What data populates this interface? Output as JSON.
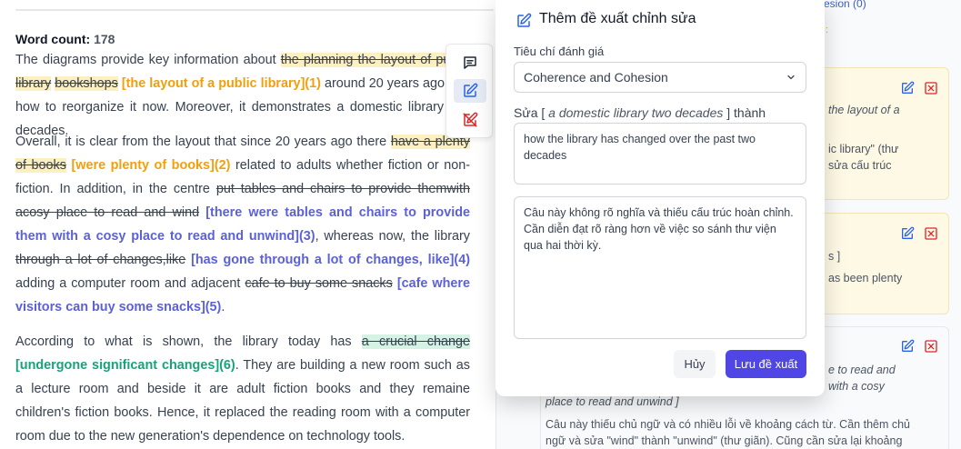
{
  "essay": {
    "word_count_label": "Word count:",
    "word_count_value": "178",
    "p1": [
      {
        "t": "The diagrams provide key information about ",
        "c": "plain"
      },
      {
        "t": "the planning the layout of public library",
        "c": "old-y"
      },
      {
        "t": " ",
        "c": "plain"
      },
      {
        "t": "bookshops",
        "c": "old-y"
      },
      {
        "t": " ",
        "c": "plain"
      },
      {
        "t": "[the layout of a public library](1)",
        "c": "sug-o"
      },
      {
        "t": " around 20 years ago and how to reorganize it now. Moreover, it demonstrates a domestic library two decades.",
        "c": "plain"
      }
    ],
    "p2": [
      {
        "t": "Overall, it is clear from the layout that since 20 years ago there ",
        "c": "plain"
      },
      {
        "t": "have a plenty of books",
        "c": "old-y"
      },
      {
        "t": " ",
        "c": "plain"
      },
      {
        "t": "[were plenty of books](2)",
        "c": "sug-o"
      },
      {
        "t": " related to adults whether fiction or non-fiction. In addition, in the centre ",
        "c": "plain"
      },
      {
        "t": "put tables and chairs to provide themwith acosy place to read and wind",
        "c": "old-b"
      },
      {
        "t": " ",
        "c": "plain"
      },
      {
        "t": "[there were tables and chairs to provide them with a cosy place to read and unwind](3)",
        "c": "sug-b"
      },
      {
        "t": ", whereas now, the library ",
        "c": "plain"
      },
      {
        "t": "through a lot of changes,like",
        "c": "old-b"
      },
      {
        "t": " ",
        "c": "plain"
      },
      {
        "t": "[has gone through a lot of changes, like](4)",
        "c": "sug-b"
      },
      {
        "t": " adding a computer room and adjacent ",
        "c": "plain"
      },
      {
        "t": "cafe to buy some snacks",
        "c": "old-b"
      },
      {
        "t": " ",
        "c": "plain"
      },
      {
        "t": "[cafe where visitors can buy some snacks](5)",
        "c": "sug-b"
      },
      {
        "t": ".",
        "c": "plain"
      }
    ],
    "p3": [
      {
        "t": "According to what is shown, the library today has ",
        "c": "plain"
      },
      {
        "t": "a crucial change",
        "c": "old-g"
      },
      {
        "t": " ",
        "c": "plain"
      },
      {
        "t": "[undergone significant changes](6)",
        "c": "sug-g"
      },
      {
        "t": ". They are building a new room such as a lecture room and beside it are adult fiction books and they remaine children's fiction books. Hence, it replaced the reading room with a computer room due to the new generation's dependence on technology tools.",
        "c": "plain"
      }
    ]
  },
  "palette": {
    "icons": [
      "comment-icon",
      "edit-icon",
      "no-edit-icon"
    ]
  },
  "sidebar": {
    "criterion_link": "esion (0)",
    "orange_fragment": ":",
    "cards": [
      {
        "fragment1": "the layout of a",
        "fragment2": "ic library\" (thư",
        "fragment3": "sửa cấu trúc"
      },
      {
        "fragment1": "s ]",
        "fragment2": "as been plenty"
      },
      {
        "fragment1": "e to read and",
        "fragment2": "with a cosy",
        "quote": "place to read and unwind ]",
        "note1": "Câu này thiếu chủ ngữ và có nhiều lỗi về khoảng cách từ. Cần thêm chủ",
        "note2": "ngữ và sửa \"wind\" thành \"unwind\" (thư giãn). Cũng cần sửa lại khoảng"
      }
    ]
  },
  "modal": {
    "title": "Thêm đề xuất chỉnh sửa",
    "criteria_label": "Tiêu chí đánh giá",
    "criteria_value": "Coherence and Cohesion",
    "edit_prefix": "Sửa [ ",
    "edit_quote": "a domestic library two decades",
    "edit_suffix": " ] thành",
    "replacement_text": "how the library has changed over the past two decades",
    "explanation_text": "Câu này không rõ nghĩa và thiếu cấu trúc hoàn chỉnh. Cần diễn đạt rõ ràng hơn về việc so sánh thư viện qua hai thời kỳ.",
    "cancel_label": "Hủy",
    "save_label": "Lưu đề xuất"
  },
  "colors": {
    "accent": "#4f46e5",
    "suggestion_orange": "#f59e0b",
    "suggestion_blue": "#5b61d8",
    "suggestion_green": "#16a37a",
    "danger": "#dc2626"
  }
}
